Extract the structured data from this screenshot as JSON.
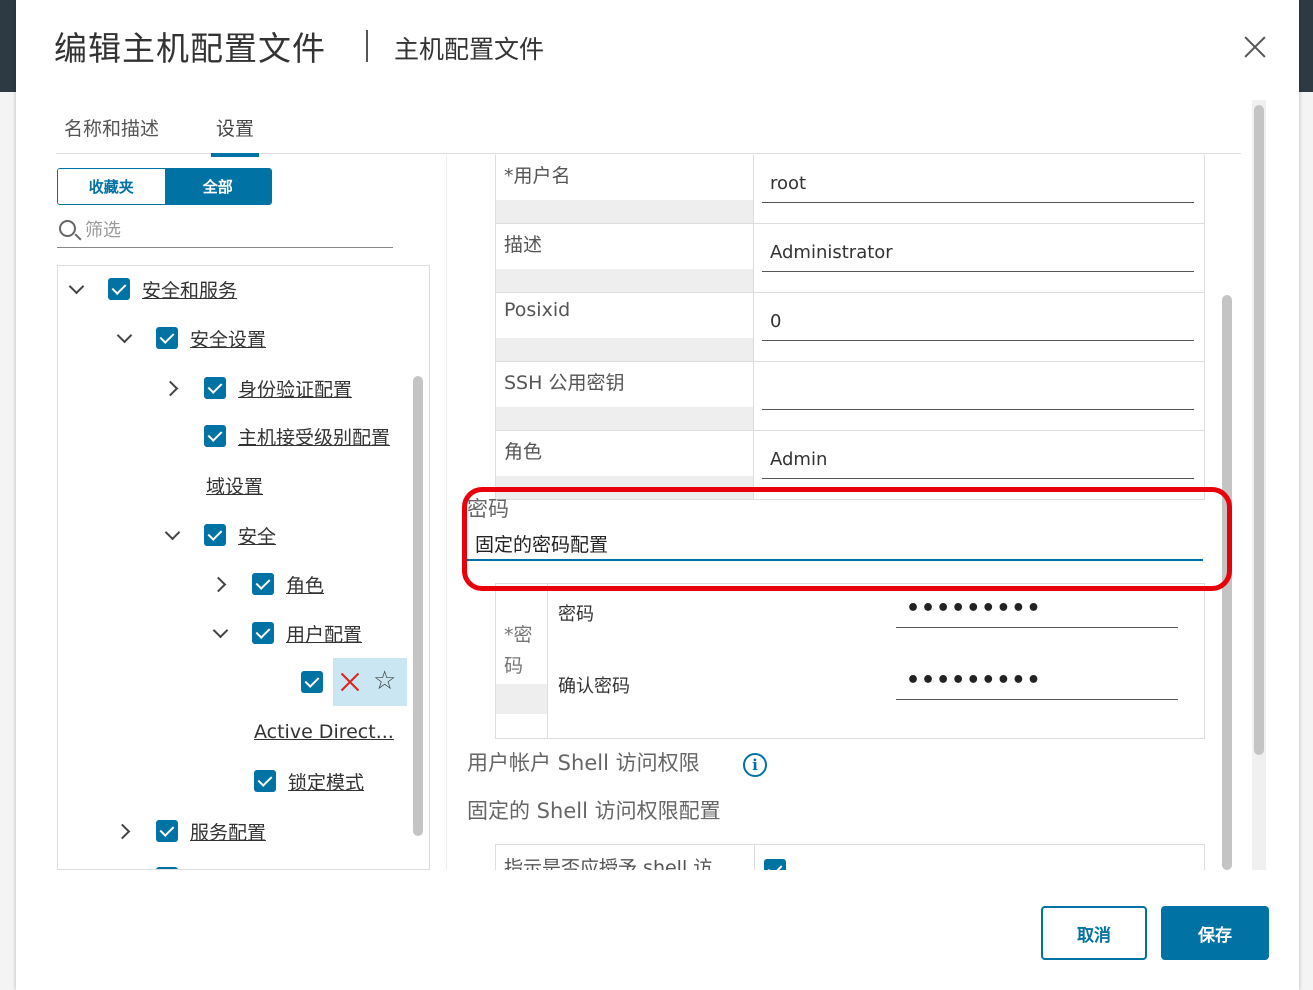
{
  "dialog": {
    "title": "编辑主机配置文件",
    "subtitle": "主机配置文件",
    "close_icon": "close-icon"
  },
  "tabs": [
    {
      "label": "名称和描述",
      "active": false
    },
    {
      "label": "设置",
      "active": true
    }
  ],
  "left_panel": {
    "segment": {
      "favorites": "收藏夹",
      "all": "全部",
      "selected": "全部"
    },
    "filter_placeholder": "筛选",
    "tree": [
      {
        "label": "安全和服务",
        "level": 0,
        "expanded": true,
        "checked": true
      },
      {
        "label": "安全设置",
        "level": 1,
        "expanded": true,
        "checked": true
      },
      {
        "label": "身份验证配置",
        "level": 2,
        "expanded": false,
        "checked": true
      },
      {
        "label": "主机接受级别配置",
        "level": 2,
        "checked": true
      },
      {
        "label": "域设置",
        "level": 2
      },
      {
        "label": "安全",
        "level": 2,
        "expanded": true,
        "checked": true
      },
      {
        "label": "角色",
        "level": 3,
        "expanded": false,
        "checked": true
      },
      {
        "label": "用户配置",
        "level": 3,
        "expanded": true,
        "checked": true
      },
      {
        "label": "",
        "level": 4,
        "checked": true,
        "selected": true
      },
      {
        "label": "Active Direct...",
        "level": 3
      },
      {
        "label": "锁定模式",
        "level": 3,
        "checked": true
      },
      {
        "label": "服务配置",
        "level": 1,
        "expanded": false,
        "checked": true
      }
    ]
  },
  "properties": [
    {
      "label": "*用户名",
      "value": "root"
    },
    {
      "label": "描述",
      "value": "Administrator"
    },
    {
      "label": "Posixid",
      "value": "0"
    },
    {
      "label": "SSH 公用密钥",
      "value": ""
    },
    {
      "label": "角色",
      "value": "Admin"
    }
  ],
  "password_section": {
    "title": "密码",
    "selected_option": "固定的密码配置",
    "group_label": "*密码",
    "password_label": "密码",
    "password_value": "•••••••••",
    "confirm_label": "确认密码",
    "confirm_value": "•••••••••"
  },
  "shell_section": {
    "title": "用户帐户 Shell 访问权限",
    "info_icon": "info-icon",
    "subtitle": "固定的 Shell 访问权限配置",
    "row_label": "指示是否应授予 shell 访",
    "checked": true
  },
  "footer": {
    "cancel": "取消",
    "save": "保存"
  },
  "colors": {
    "accent": "#0072a3",
    "highlight": "#e8000b"
  }
}
